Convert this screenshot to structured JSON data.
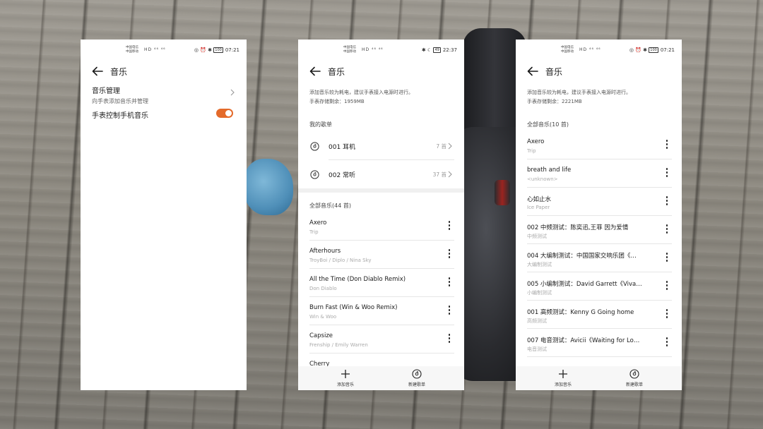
{
  "status_bar": {
    "carrier_line1": "中国电信",
    "carrier_line2": "中国移动",
    "icons_left": "HD ⁴⁶ ⁴⁶",
    "left_phone_time": "07:21",
    "mid_phone_time": "22:37",
    "right_phone_time": "07:21",
    "battery_left": "100",
    "battery_mid": "49",
    "battery_right": "100"
  },
  "left_phone": {
    "title": "音乐",
    "settings": [
      {
        "label": "音乐管理",
        "sub": "向手表添加音乐并管理"
      },
      {
        "label": "手表控制手机音乐",
        "toggle_on": true
      }
    ]
  },
  "mid_phone": {
    "title": "音乐",
    "note_line1": "添加音乐较为耗电，建议手表接入电源时进行。",
    "storage": "手表存储剩余：1959MB",
    "playlists_header": "我的歌单",
    "playlists": [
      {
        "name": "001 耳机",
        "count": "7 首"
      },
      {
        "name": "002 常听",
        "count": "37 首"
      }
    ],
    "all_header": "全部音乐(44 首)",
    "songs": [
      {
        "title": "Axero",
        "artist": "Trip"
      },
      {
        "title": "Afterhours",
        "artist": "TroyBoi / Diplo / Nina Sky"
      },
      {
        "title": "All the Time (Don Diablo Remix)",
        "artist": "Don Diablo"
      },
      {
        "title": "Burn Fast (Win & Woo Remix)",
        "artist": "Win & Woo"
      },
      {
        "title": "Capsize",
        "artist": "Frenship / Emily Warren"
      },
      {
        "title": "Cherry",
        "artist": ""
      }
    ],
    "add_music": "添加音乐",
    "new_playlist": "新建歌单"
  },
  "right_phone": {
    "title": "音乐",
    "note_line1": "添加音乐较为耗电，建议手表接入电源时进行。",
    "storage": "手表存储剩余：2221MB",
    "all_header": "全部音乐(10 首)",
    "songs": [
      {
        "title": "Axero",
        "artist": "Trip"
      },
      {
        "title": "breath and life",
        "artist": "<unknown>"
      },
      {
        "title": "心如止水",
        "artist": "Ice Paper"
      },
      {
        "title": "002 中频测试：陈奕迅,王菲 因为爱情",
        "artist": "中频测试"
      },
      {
        "title": "004 大编制测试：中国国家交响乐团《…",
        "artist": "大编制测试"
      },
      {
        "title": "005 小编制测试：David Garrett《Viva…",
        "artist": "小编制测试"
      },
      {
        "title": "001 高频测试：Kenny G  Going home",
        "artist": "高频测试"
      },
      {
        "title": "007 电音测试：Avicii《Waiting for Lo…",
        "artist": "电音测试"
      }
    ],
    "add_music": "添加音乐",
    "new_playlist": "新建歌单"
  },
  "colors": {
    "toggle_accent": "#e46a2a",
    "page_bg": "#ffffff"
  }
}
